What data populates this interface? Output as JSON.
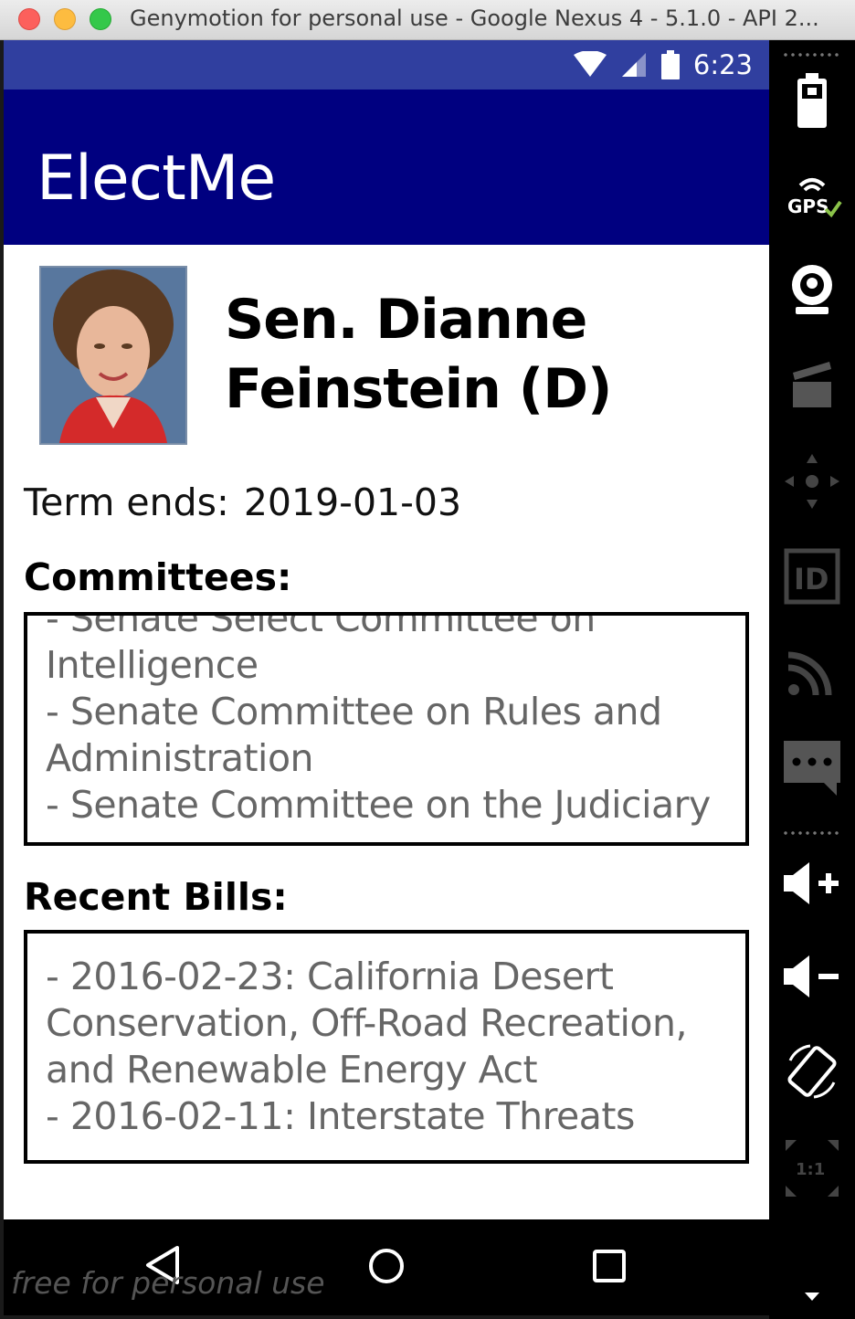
{
  "window": {
    "title": "Genymotion for personal use - Google Nexus 4 - 5.1.0 - API 2..."
  },
  "statusbar": {
    "time": "6:23"
  },
  "app": {
    "title": "ElectMe",
    "appbar_color": "#000080",
    "statusbar_color": "#303f9f"
  },
  "profile": {
    "name": "Sen. Dianne Feinstein (D)",
    "term_label": "Term ends:",
    "term_date": "2019-01-03"
  },
  "committees": {
    "label": "Committees:",
    "items": [
      " - Senate Select Committee on Intelligence",
      " - Senate Committee on Rules and Administration",
      " - Senate Committee on the Judiciary"
    ]
  },
  "bills": {
    "label": "Recent Bills:",
    "items": [
      " - 2016-02-23: California Desert Conservation, Off-Road Recreation, and Renewable Energy Act",
      " - 2016-02-11: Interstate Threats"
    ]
  },
  "navbar": {
    "back_icon": "back-triangle-icon",
    "home_icon": "home-circle-icon",
    "recents_icon": "recents-square-icon",
    "watermark": "free for personal use"
  },
  "sidebar": {
    "gps_label": "GPS",
    "id_label": "ID",
    "scale_label": "1:1",
    "icons": [
      "battery-icon",
      "gps-icon",
      "webcam-icon",
      "capture-icon",
      "dpad-icon",
      "id-icon",
      "cast-icon",
      "sms-icon",
      "volume-up-icon",
      "volume-down-icon",
      "rotate-icon",
      "scale-icon"
    ]
  }
}
